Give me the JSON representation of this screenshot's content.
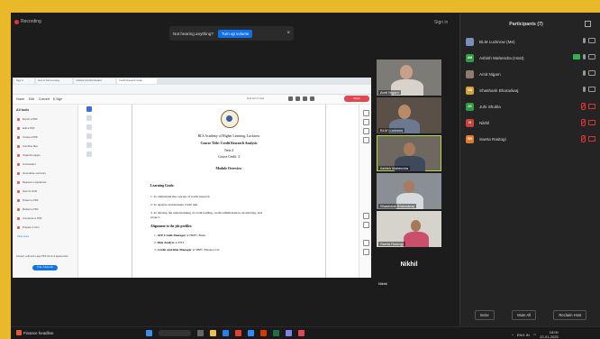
{
  "meeting": {
    "recording_label": "Recording",
    "signin_label": "Sign in",
    "toast": {
      "message": "Not hearing anything?",
      "button": "Turn up volume",
      "close": "×"
    }
  },
  "shared_doc": {
    "tabs": [
      "Sign In",
      "How to find an essay",
      "Untitled (Acrobat Reader)",
      "Credit Research Analy..."
    ],
    "menu": [
      "Home",
      "Edit",
      "Convert",
      "E-Sign"
    ],
    "search_hint": "Find text or tools",
    "share_label": "Share",
    "sidebar_head": "All tools",
    "sidebar_items": [
      "Export a PDF",
      "Edit a PDF",
      "Create a PDF",
      "Combine files",
      "Organize pages",
      "AI Assistant",
      "Generative summary",
      "Request e-signatures",
      "Scan & OCR",
      "Protect a PDF",
      "Redact a PDF",
      "Compress a PDF",
      "Prepare a form",
      "View more"
    ],
    "sidebar_footer": "Convert, edit and e-sign PDF forms & agreements",
    "sidebar_button": "Free 7-day trial",
    "lines": {
      "org": "BLS Academy of Higher Learning, Lucknow",
      "course_title": "Course Title: Credit Research Analysis",
      "term": "Term 4",
      "credits": "Course Credit: 3",
      "overview": "Module Overview",
      "goals": "Learning Goals:",
      "g1": "1. To understand the concept of credit research.",
      "g2": "2. To analyze and measure credit risk.",
      "g3a": "3. To develop the understanding of credit lending, credit administration, monitoring, and",
      "g3b": "project.",
      "align": "Alignment to the job profiles:",
      "j1_role": "AVP Credit Manager",
      "j1_at": "at HDFC Bank",
      "j2_role": "Risk Analyst",
      "j2_at": "at EXT",
      "j3_role": "Credit and Risk Manager",
      "j3_at": "at SBFC Finance Ltd"
    }
  },
  "videos": [
    {
      "name": "Amit Nigam"
    },
    {
      "name": "BLM Lucknow"
    },
    {
      "name": "Ashish Mahendra"
    },
    {
      "name": "Shashank Bharadwaj"
    },
    {
      "name": "Sweta Rastogi"
    }
  ],
  "nikhil_tile": {
    "big_name": "Nikhil",
    "small_name": "Nikhil"
  },
  "participants_panel": {
    "title": "Participants (7)",
    "items": [
      {
        "initials": "",
        "name": "BLM Lucknow (Me)",
        "color": "#7a8fb8"
      },
      {
        "initials": "AM",
        "name": "Ashish Mahendra (Host)",
        "color": "#2e9b47"
      },
      {
        "initials": "",
        "name": "Amit Nigam",
        "color": "#8f7c6c"
      },
      {
        "initials": "SB",
        "name": "Shashank Bharadwaj",
        "color": "#d4a137"
      },
      {
        "initials": "JS",
        "name": "Juhi Shukla",
        "color": "#2e9b47"
      },
      {
        "initials": "N",
        "name": "Nikhil",
        "color": "#c9433a"
      },
      {
        "initials": "SR",
        "name": "Sweta Rastogi",
        "color": "#e07b2e"
      }
    ],
    "buttons": [
      "Invite",
      "Mute All",
      "Reclaim Host"
    ]
  },
  "taskbar": {
    "news_label": "Finance headline",
    "lang": "ENG",
    "region": "IN",
    "time": "18:09",
    "date": "22-01-2025"
  }
}
